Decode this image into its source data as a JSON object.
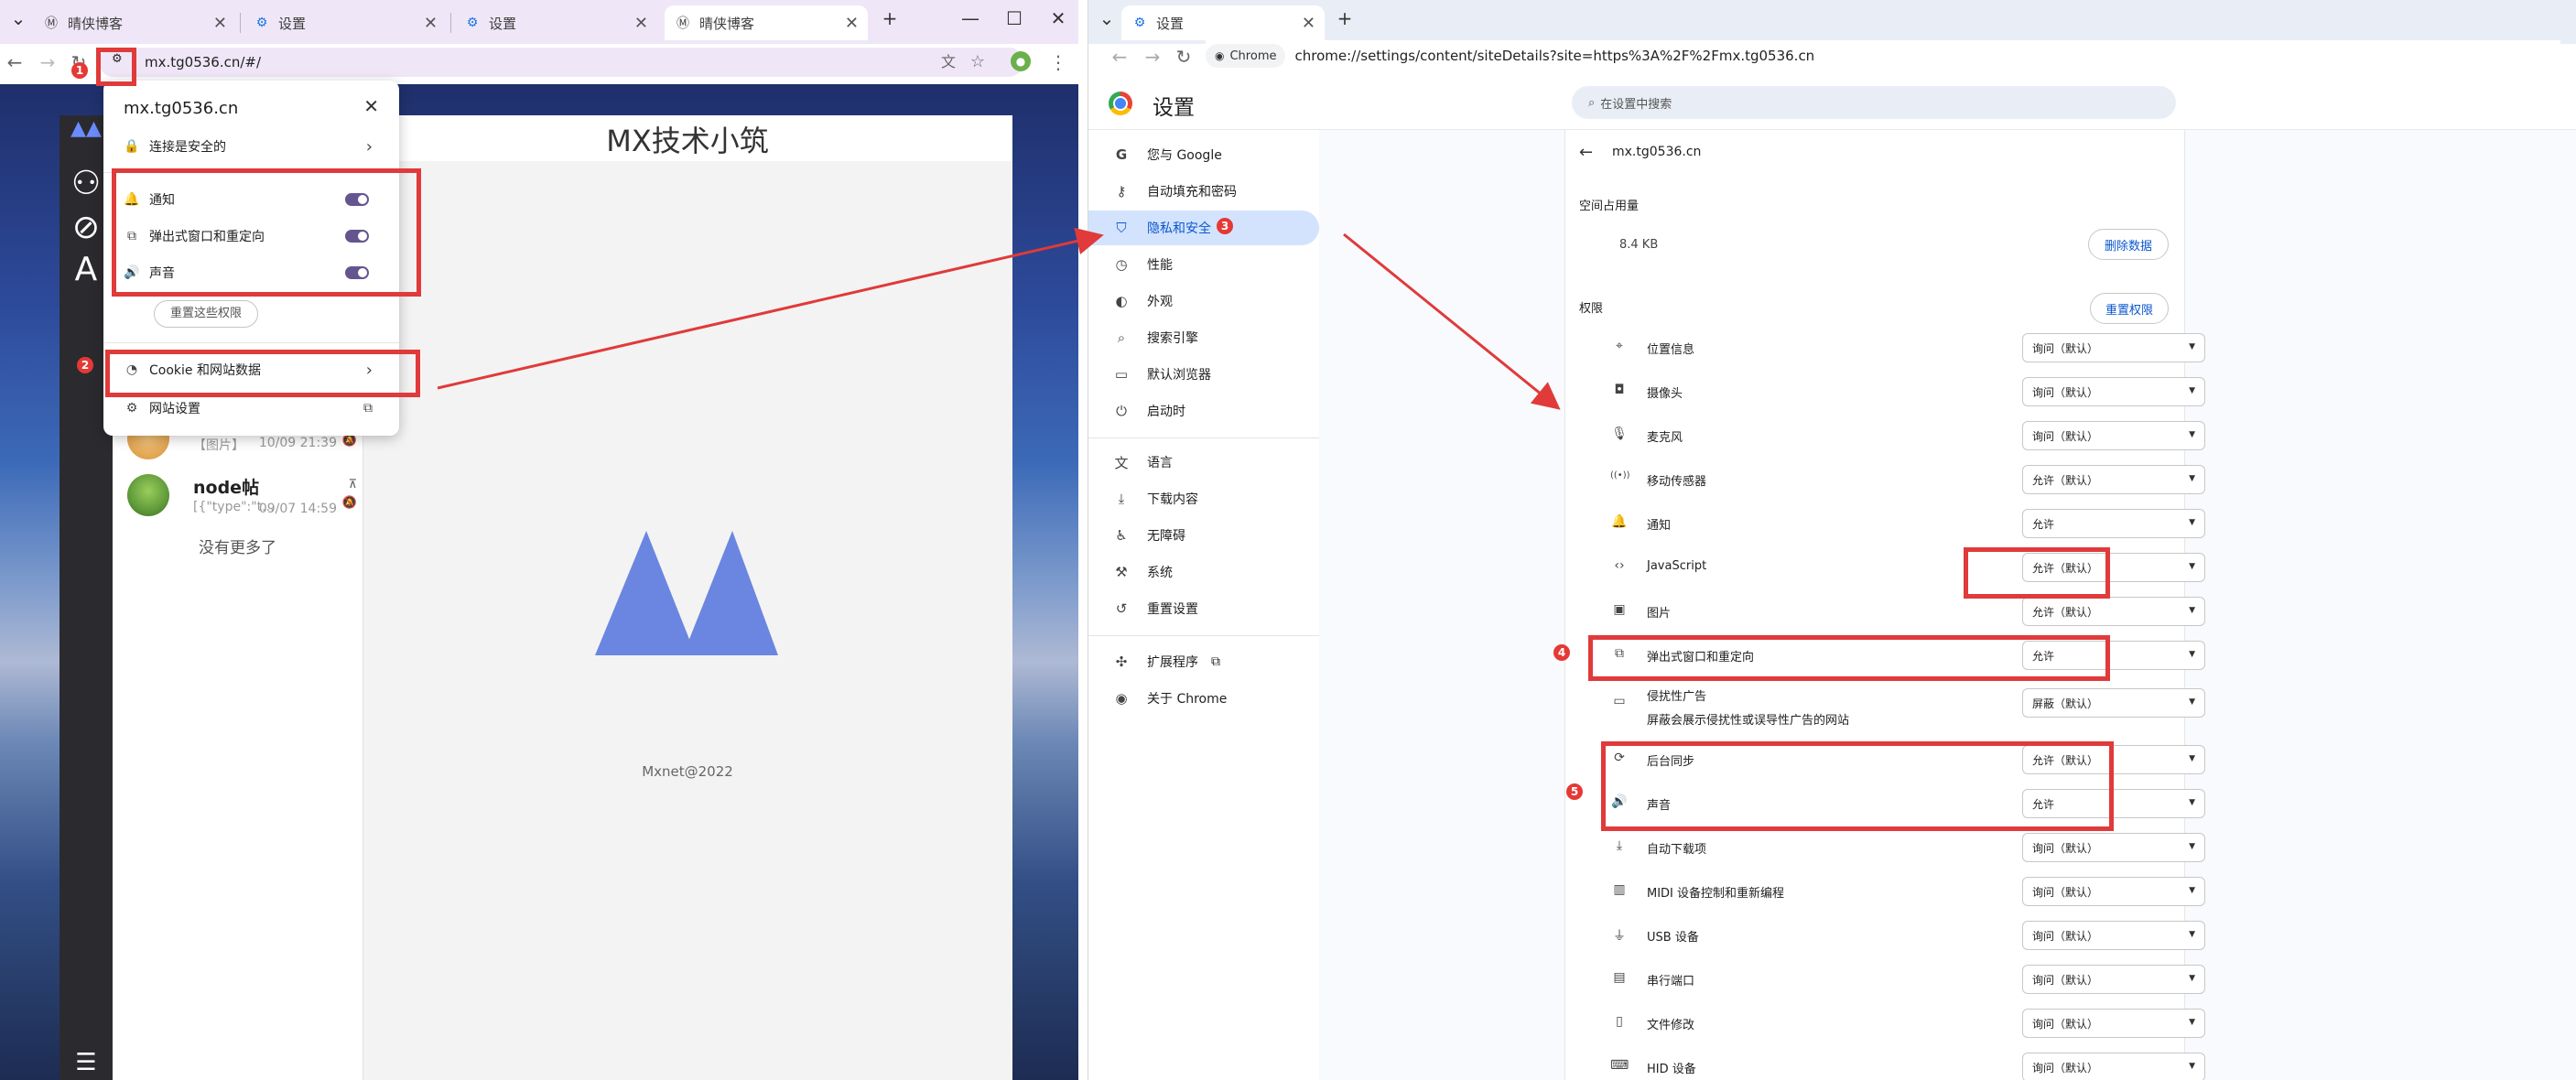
{
  "left_window": {
    "tabs": [
      {
        "label": "晴侠博客"
      },
      {
        "label": "设置"
      },
      {
        "label": "设置"
      },
      {
        "label": "晴侠博客"
      }
    ],
    "url": "mx.tg0536.cn/#/",
    "app_title": "MX技术小筑",
    "list_items": [
      {
        "title": "",
        "sub": "【图片】",
        "time": "10/09 21:39"
      },
      {
        "title": "node帖",
        "sub": "[{\"type\":\"t...",
        "time": "09/07 14:59"
      }
    ],
    "no_more": "没有更多了",
    "footer": "Mxnet@2022",
    "popup": {
      "host": "mx.tg0536.cn",
      "secure": "连接是安全的",
      "permissions": [
        {
          "label": "通知",
          "icon": "bell-icon"
        },
        {
          "label": "弹出式窗口和重定向",
          "icon": "external-link-icon"
        },
        {
          "label": "声音",
          "icon": "speaker-icon"
        }
      ],
      "reset_label": "重置这些权限",
      "cookie_label": "Cookie 和网站数据",
      "site_settings_label": "网站设置"
    }
  },
  "right_window": {
    "tab_label": "设置",
    "chip_label": "Chrome",
    "url": "chrome://settings/content/siteDetails?site=https%3A%2F%2Fmx.tg0536.cn",
    "settings_title": "设置",
    "search_placeholder": "在设置中搜索",
    "nav": [
      {
        "label": "您与 Google",
        "icon": "google-g-icon"
      },
      {
        "label": "自动填充和密码",
        "icon": "key-icon"
      },
      {
        "label": "隐私和安全",
        "icon": "shield-icon",
        "active": true
      },
      {
        "label": "性能",
        "icon": "speedometer-icon"
      },
      {
        "label": "外观",
        "icon": "palette-icon"
      },
      {
        "label": "搜索引擎",
        "icon": "search-icon"
      },
      {
        "label": "默认浏览器",
        "icon": "browser-icon"
      },
      {
        "label": "启动时",
        "icon": "power-icon"
      },
      {
        "label": "语言",
        "icon": "translate-icon"
      },
      {
        "label": "下载内容",
        "icon": "download-icon"
      },
      {
        "label": "无障碍",
        "icon": "accessibility-icon"
      },
      {
        "label": "系统",
        "icon": "wrench-icon"
      },
      {
        "label": "重置设置",
        "icon": "reset-icon"
      },
      {
        "label": "扩展程序",
        "icon": "puzzle-icon"
      },
      {
        "label": "关于 Chrome",
        "icon": "chrome-icon"
      }
    ],
    "site_host": "mx.tg0536.cn",
    "usage_title": "空间占用量",
    "usage_value": "8.4 KB",
    "delete_label": "删除数据",
    "perms_title": "权限",
    "reset_perms_label": "重置权限",
    "permissions": [
      {
        "label": "位置信息",
        "icon": "location-icon",
        "value": "询问（默认）"
      },
      {
        "label": "摄像头",
        "icon": "camera-icon",
        "value": "询问（默认）"
      },
      {
        "label": "麦克风",
        "icon": "mic-icon",
        "value": "询问（默认）"
      },
      {
        "label": "移动传感器",
        "icon": "sensor-icon",
        "value": "允许（默认）"
      },
      {
        "label": "通知",
        "icon": "bell-icon",
        "value": "允许"
      },
      {
        "label": "JavaScript",
        "icon": "code-icon",
        "value": "允许（默认）"
      },
      {
        "label": "图片",
        "icon": "image-icon",
        "value": "允许（默认）"
      },
      {
        "label": "弹出式窗口和重定向",
        "icon": "external-link-icon",
        "value": "允许"
      },
      {
        "label": "侵扰性广告",
        "sub": "屏蔽会展示侵扰性或误导性广告的网站",
        "icon": "ad-icon",
        "value": "屏蔽（默认）"
      },
      {
        "label": "后台同步",
        "icon": "sync-icon",
        "value": "允许（默认）"
      },
      {
        "label": "声音",
        "icon": "speaker-icon",
        "value": "允许"
      },
      {
        "label": "自动下载项",
        "icon": "download-icon",
        "value": "询问（默认）"
      },
      {
        "label": "MIDI 设备控制和重新编程",
        "icon": "midi-icon",
        "value": "询问（默认）"
      },
      {
        "label": "USB 设备",
        "icon": "usb-icon",
        "value": "询问（默认）"
      },
      {
        "label": "串行端口",
        "icon": "serial-icon",
        "value": "询问（默认）"
      },
      {
        "label": "文件修改",
        "icon": "file-icon",
        "value": "询问（默认）"
      },
      {
        "label": "HID 设备",
        "icon": "hid-icon",
        "value": "询问（默认）"
      }
    ]
  },
  "annotations": {
    "badges": [
      "1",
      "2",
      "3",
      "4",
      "5"
    ],
    "color": "#e03a3a"
  }
}
